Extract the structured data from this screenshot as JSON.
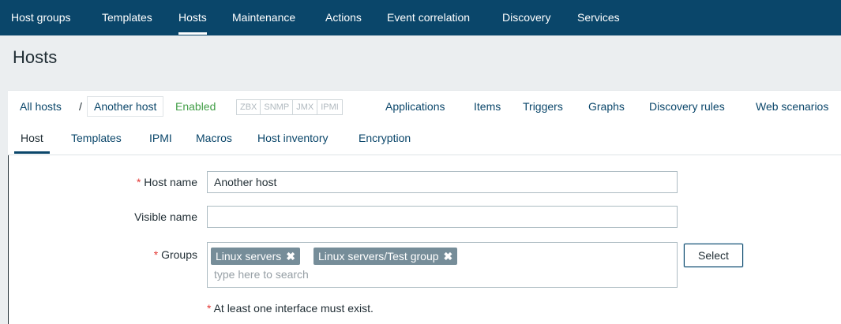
{
  "top_nav": {
    "items": [
      {
        "label": "Host groups",
        "active": false
      },
      {
        "label": "Templates",
        "active": false
      },
      {
        "label": "Hosts",
        "active": true
      },
      {
        "label": "Maintenance",
        "active": false
      },
      {
        "label": "Actions",
        "active": false
      },
      {
        "label": "Event correlation",
        "active": false
      },
      {
        "label": "Discovery",
        "active": false
      },
      {
        "label": "Services",
        "active": false
      }
    ]
  },
  "page": {
    "title": "Hosts"
  },
  "breadcrumb": {
    "all_hosts": "All hosts",
    "separator": "/",
    "current": "Another host",
    "status": "Enabled",
    "availability": [
      "ZBX",
      "SNMP",
      "JMX",
      "IPMI"
    ],
    "links": [
      "Applications",
      "Items",
      "Triggers",
      "Graphs",
      "Discovery rules",
      "Web scenarios"
    ]
  },
  "tabs": [
    {
      "label": "Host",
      "active": true
    },
    {
      "label": "Templates",
      "active": false
    },
    {
      "label": "IPMI",
      "active": false
    },
    {
      "label": "Macros",
      "active": false
    },
    {
      "label": "Host inventory",
      "active": false
    },
    {
      "label": "Encryption",
      "active": false
    }
  ],
  "form": {
    "required_mark": "*",
    "host_name_label": "Host name",
    "host_name_value": "Another host",
    "visible_name_label": "Visible name",
    "visible_name_value": "",
    "groups_label": "Groups",
    "groups": [
      "Linux servers",
      "Linux servers/Test group"
    ],
    "chip_remove_glyph": "✖",
    "groups_placeholder": "type here to search",
    "select_button": "Select",
    "interface_note": "At least one interface must exist."
  },
  "colors": {
    "nav_bg": "#0a466a",
    "link": "#0a466a",
    "enabled": "#429e47",
    "required": "#e33734",
    "chip": "#768d99"
  }
}
